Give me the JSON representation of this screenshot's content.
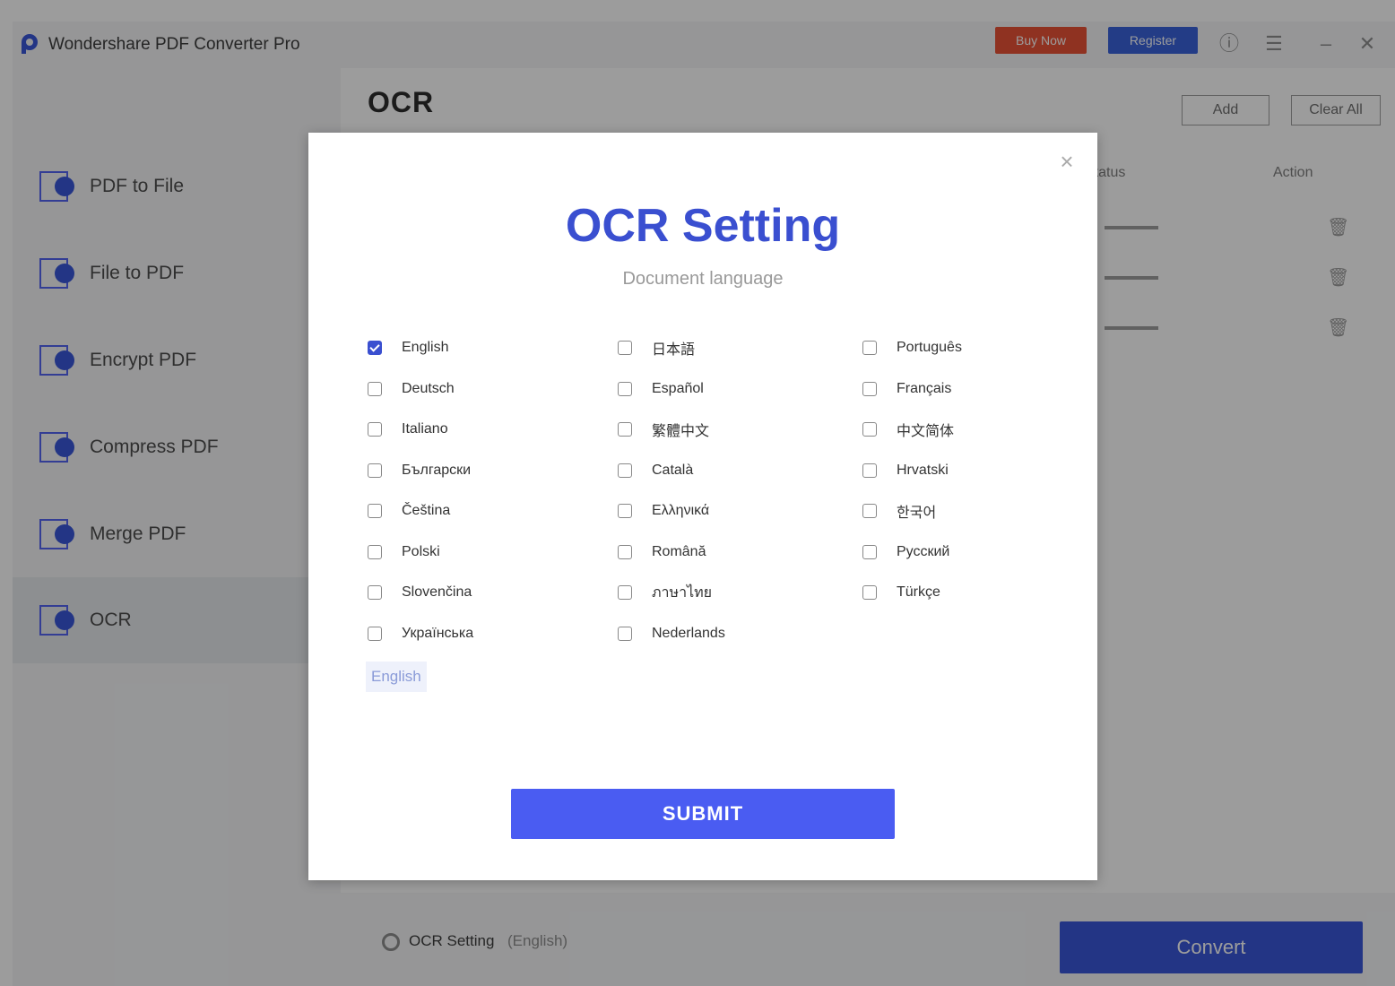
{
  "app": {
    "title": "Wondershare PDF Converter Pro",
    "buy_label": "Buy Now",
    "register_label": "Register"
  },
  "sidebar": {
    "items": [
      {
        "label": "PDF to File",
        "icon": "pdf-to-file-icon"
      },
      {
        "label": "File to PDF",
        "icon": "file-to-pdf-icon"
      },
      {
        "label": "Encrypt PDF",
        "icon": "encrypt-pdf-icon"
      },
      {
        "label": "Compress PDF",
        "icon": "compress-pdf-icon"
      },
      {
        "label": "Merge PDF",
        "icon": "merge-pdf-icon"
      },
      {
        "label": "OCR",
        "icon": "ocr-icon",
        "active": true
      }
    ]
  },
  "main": {
    "title": "OCR",
    "add_label": "Add",
    "clear_label": "Clear All",
    "columns": [
      "Status",
      "Action"
    ],
    "footer": {
      "ocr_setting_label": "OCR Setting",
      "ocr_setting_value": "(English)",
      "convert_label": "Convert"
    }
  },
  "dialog": {
    "title": "OCR Setting",
    "subtitle": "Document language",
    "languages": [
      {
        "label": "English",
        "checked": true
      },
      {
        "label": "日本語",
        "checked": false
      },
      {
        "label": "Português",
        "checked": false
      },
      {
        "label": "Deutsch",
        "checked": false
      },
      {
        "label": "Español",
        "checked": false
      },
      {
        "label": "Français",
        "checked": false
      },
      {
        "label": "Italiano",
        "checked": false
      },
      {
        "label": "繁體中文",
        "checked": false
      },
      {
        "label": "中文简体",
        "checked": false
      },
      {
        "label": "Български",
        "checked": false
      },
      {
        "label": "Català",
        "checked": false
      },
      {
        "label": "Hrvatski",
        "checked": false
      },
      {
        "label": "Čeština",
        "checked": false
      },
      {
        "label": "Ελληνικά",
        "checked": false
      },
      {
        "label": "한국어",
        "checked": false
      },
      {
        "label": "Polski",
        "checked": false
      },
      {
        "label": "Română",
        "checked": false
      },
      {
        "label": "Русский",
        "checked": false
      },
      {
        "label": "Slovenčina",
        "checked": false
      },
      {
        "label": "ภาษาไทย",
        "checked": false
      },
      {
        "label": "Türkçe",
        "checked": false
      },
      {
        "label": "Українська",
        "checked": false
      },
      {
        "label": "Nederlands",
        "checked": false
      }
    ],
    "selected_summary": "English",
    "submit_label": "SUBMIT"
  },
  "colors": {
    "accent": "#3a4fd0",
    "submit": "#4a5cf2",
    "convert": "#2f4fd8",
    "buy": "#e8492c",
    "register": "#2f5bd9"
  }
}
